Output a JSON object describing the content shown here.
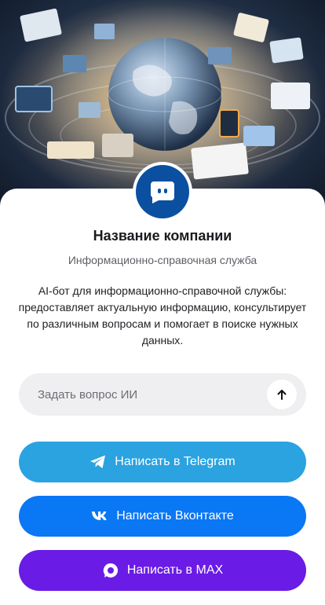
{
  "company": {
    "name": "Название компании",
    "subtitle": "Информационно-справочная служба",
    "description": "AI-бот для информационно-справочной службы: предоставляет актуальную информацию, консультирует по различным вопросам и помогает в поиске нужных данных."
  },
  "hero": {
    "image_icon": "globe-with-books-and-devices"
  },
  "avatar": {
    "icon": "chat-bot-icon",
    "color": "#0b4fa0"
  },
  "ask": {
    "placeholder": "Задать вопрос ИИ",
    "value": "",
    "send_icon": "arrow-up-icon"
  },
  "buttons": {
    "telegram": {
      "label": "Написать в Telegram",
      "icon": "telegram-icon",
      "color": "#2aa3e0"
    },
    "vk": {
      "label": "Написать Вконтакте",
      "icon": "vk-icon",
      "color": "#0a77f5"
    },
    "max": {
      "label": "Написать в MAX",
      "icon": "max-icon",
      "color": "#6a1be6"
    }
  }
}
